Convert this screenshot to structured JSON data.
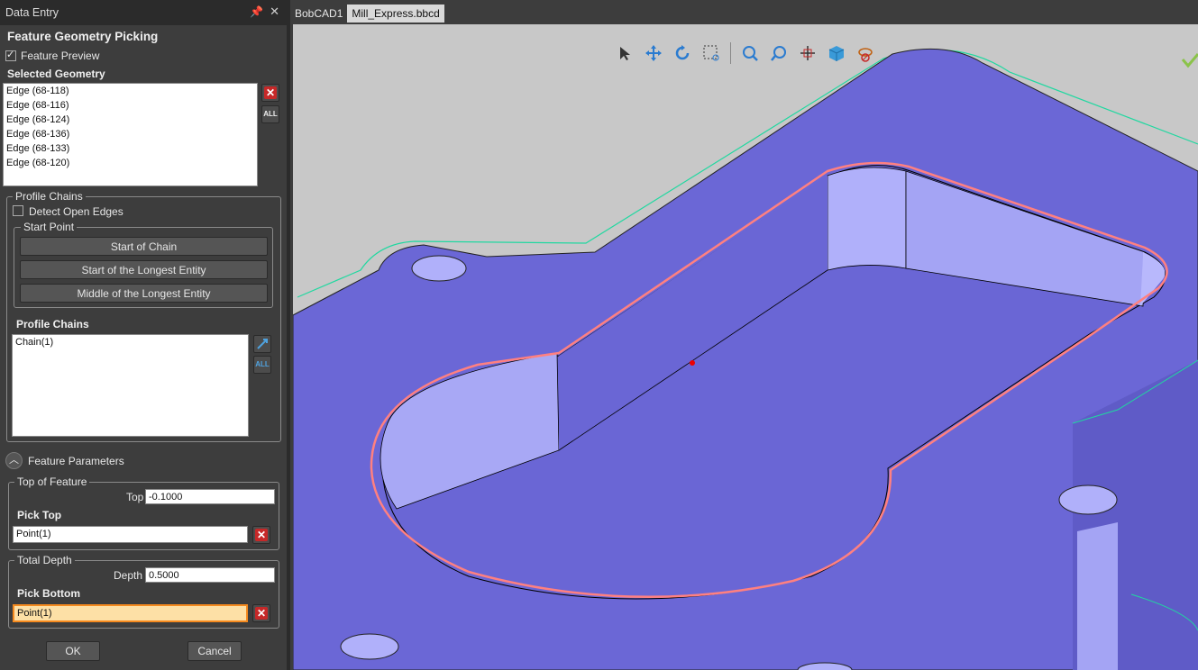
{
  "panel": {
    "title": "Data Entry",
    "heading": "Feature Geometry Picking",
    "feature_preview_label": "Feature Preview",
    "selected_geometry_label": "Selected Geometry",
    "selected_geometry": [
      "Edge (68-118)",
      "Edge (68-116)",
      "Edge (68-124)",
      "Edge (68-136)",
      "Edge (68-133)",
      "Edge (68-120)"
    ],
    "all_label": "ALL",
    "profile_chains_group": "Profile Chains",
    "detect_open_edges_label": "Detect Open Edges",
    "start_point_group": "Start Point",
    "start_of_chain": "Start of Chain",
    "start_longest": "Start of the Longest Entity",
    "middle_longest": "Middle of the Longest Entity",
    "profile_chains_label": "Profile Chains",
    "chains": [
      "Chain(1)"
    ],
    "feature_parameters_label": "Feature Parameters",
    "top_of_feature_group": "Top of Feature",
    "top_label": "Top",
    "top_value": "-0.1000",
    "pick_top_label": "Pick Top",
    "pick_top_value": "Point(1)",
    "total_depth_group": "Total Depth",
    "depth_label": "Depth",
    "depth_value": "0.5000",
    "pick_bottom_label": "Pick Bottom",
    "pick_bottom_value": "Point(1)",
    "ok_label": "OK",
    "cancel_label": "Cancel"
  },
  "tabs": [
    "BobCAD1",
    "Mill_Express.bbcd"
  ],
  "toolbar_icons": [
    "select-arrow-icon",
    "pan-icon",
    "rotate-icon",
    "zoom-window-icon",
    "zoom-fit-icon",
    "zoom-icon",
    "center-icon",
    "view-cube-icon",
    "hide-icon"
  ],
  "colors": {
    "part": "#6b67d6",
    "wall": "#a8a8f5",
    "chain": "#ff8080",
    "toolpath": "#20e0a0",
    "bg": "#c8c8c8"
  }
}
